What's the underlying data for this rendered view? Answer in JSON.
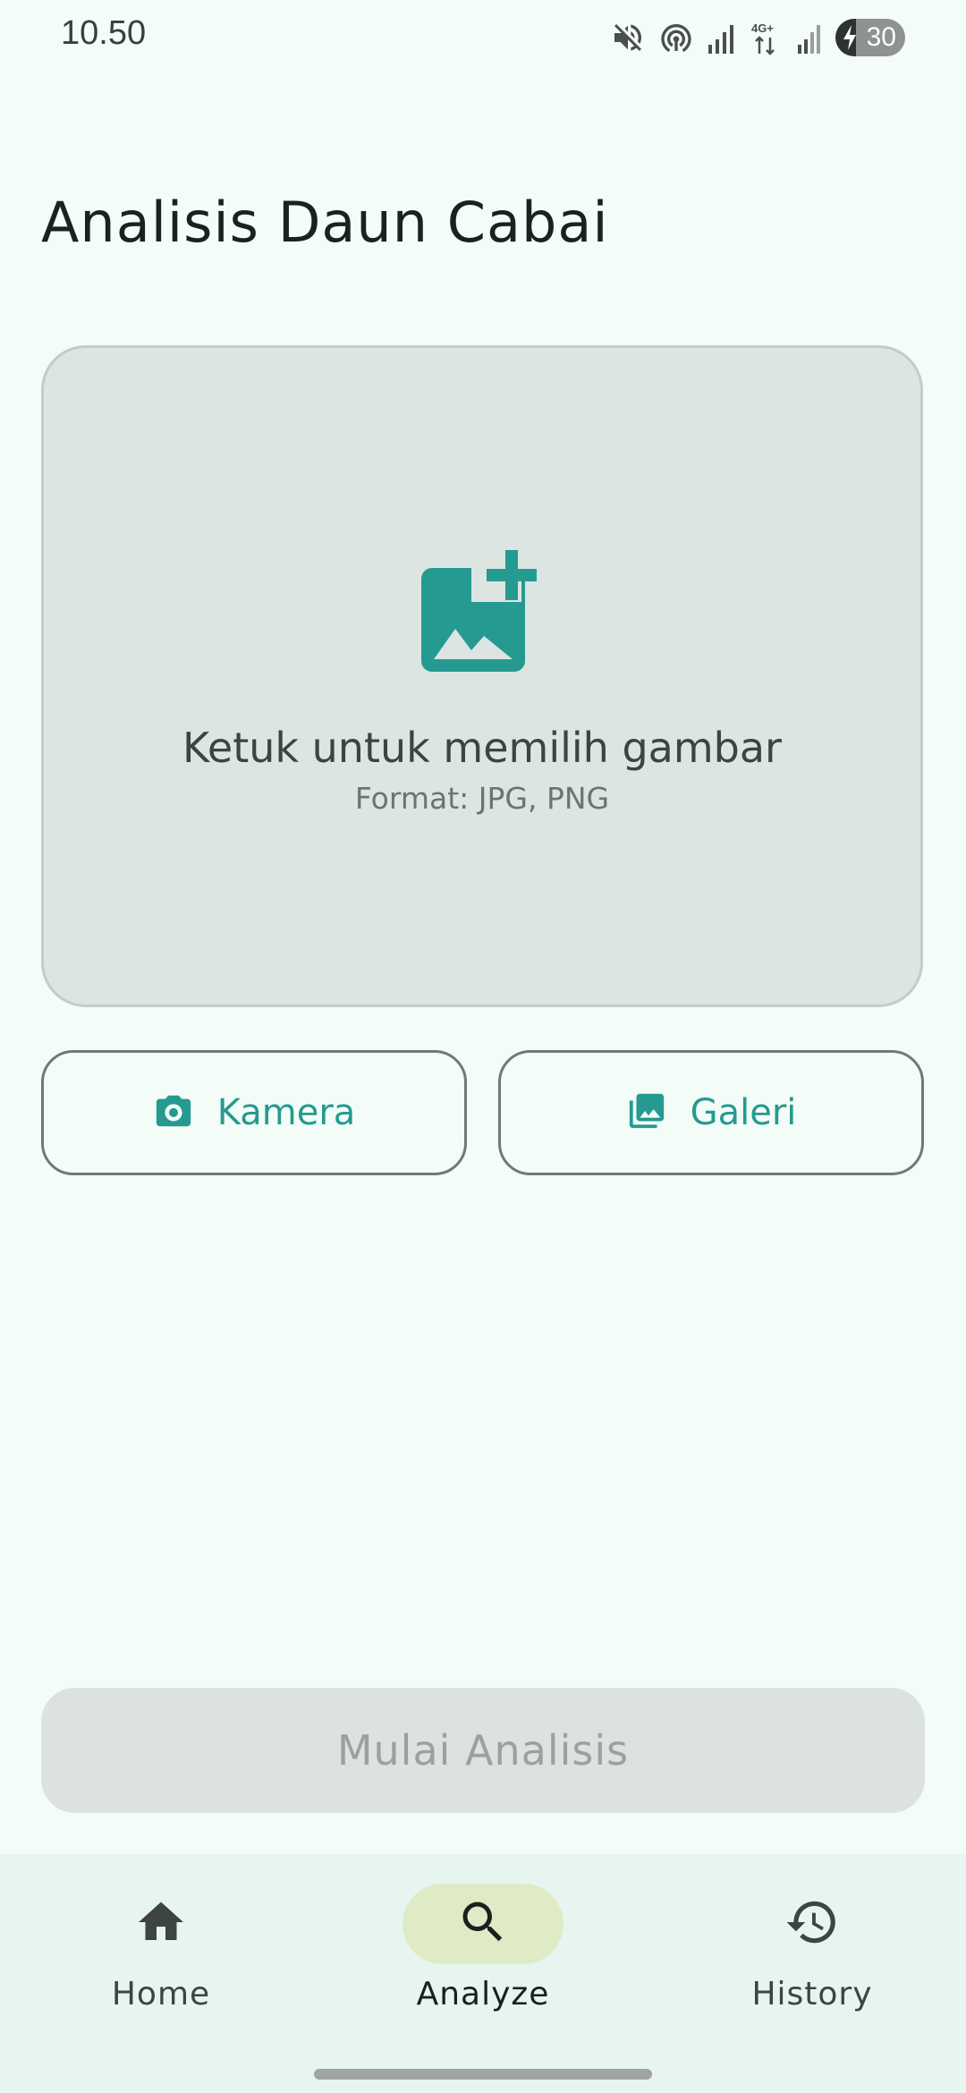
{
  "status_bar": {
    "time": "10.50",
    "network_label": "4G+",
    "battery_level": "30",
    "battery_fraction": 0.3,
    "icons": [
      "mute-icon",
      "hotspot-icon",
      "signal-icon",
      "data-4g-icon",
      "signal-icon",
      "battery-charging-icon"
    ]
  },
  "page": {
    "title": "Analisis Daun Cabai"
  },
  "picker": {
    "icon": "add-photo-icon",
    "title": "Ketuk untuk memilih gambar",
    "subtitle": "Format: JPG, PNG"
  },
  "actions": {
    "camera_label": "Kamera",
    "camera_icon": "camera-icon",
    "gallery_label": "Galeri",
    "gallery_icon": "gallery-icon",
    "primary_label": "Mulai Analisis",
    "primary_enabled": false
  },
  "nav": {
    "items": [
      {
        "label": "Home",
        "icon": "home-icon",
        "active": false
      },
      {
        "label": "Analyze",
        "icon": "search-icon",
        "active": true
      },
      {
        "label": "History",
        "icon": "history-icon",
        "active": false
      }
    ]
  },
  "colors": {
    "background": "#F3FCF7",
    "accent": "#259A90",
    "picker_bg": "#DCE5E1",
    "nav_bg": "#E6F5F0",
    "nav_active_pill": "#DEEBC5",
    "disabled_button": "#DCE2DF"
  }
}
